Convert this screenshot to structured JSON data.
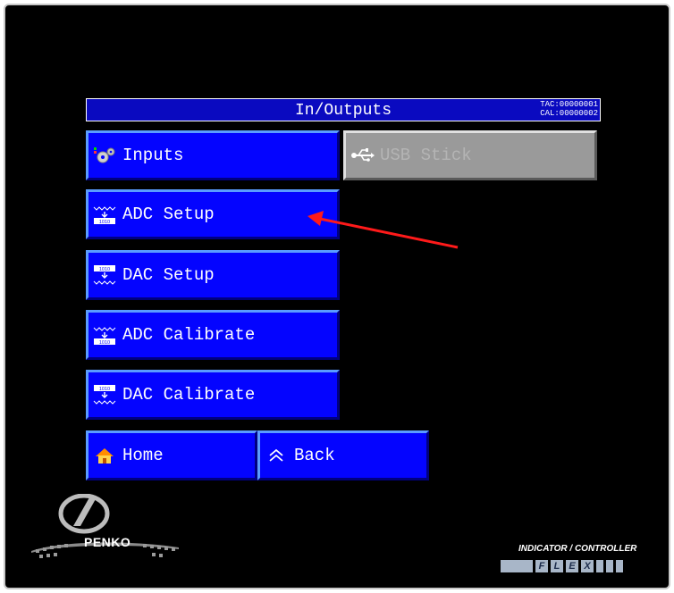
{
  "header": {
    "title": "In/Outputs",
    "tac": "TAC:00000001",
    "cal": "CAL:00000002"
  },
  "buttons": {
    "inputs": {
      "label": "Inputs",
      "icon": "gears-icon"
    },
    "usb_stick": {
      "label": "USB Stick",
      "icon": "usb-icon",
      "enabled": false
    },
    "adc_setup": {
      "label": "ADC Setup",
      "icon": "adc-icon"
    },
    "dac_setup": {
      "label": "DAC Setup",
      "icon": "dac-icon"
    },
    "adc_calibrate": {
      "label": "ADC Calibrate",
      "icon": "adc-icon"
    },
    "dac_calibrate": {
      "label": "DAC Calibrate",
      "icon": "dac-icon"
    },
    "home": {
      "label": "Home",
      "icon": "home-icon"
    },
    "back": {
      "label": "Back",
      "icon": "double-chevron-up-icon"
    }
  },
  "branding": {
    "logo": "PENKO",
    "logo_subtitle": "",
    "product_line": "INDICATOR / CONTROLLER",
    "product_letters": [
      "",
      "F",
      "L",
      "E",
      "X",
      "",
      "",
      ""
    ]
  },
  "annotation": {
    "color": "#ff0000",
    "points_to": "adc-setup-button"
  },
  "colors": {
    "button": "#0404ff",
    "title_bar": "#0a0ac0",
    "background": "#000000",
    "disabled": "#9a9a9a"
  }
}
